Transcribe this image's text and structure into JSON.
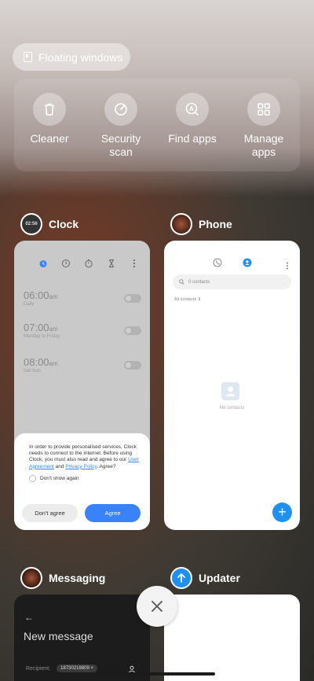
{
  "floating_windows": {
    "label": "Floating windows"
  },
  "quick_actions": [
    {
      "label": "Cleaner",
      "icon": "trash-icon"
    },
    {
      "label": "Security\nscan",
      "icon": "security-scan-icon"
    },
    {
      "label": "Find apps",
      "icon": "find-apps-icon"
    },
    {
      "label": "Manage\napps",
      "icon": "grid-icon"
    }
  ],
  "apps": {
    "clock": {
      "name": "Clock",
      "icon_text": "02:56",
      "alarms": [
        {
          "time": "06:00",
          "ampm": "am",
          "repeat": "Daily"
        },
        {
          "time": "07:00",
          "ampm": "am",
          "repeat": "Monday to Friday"
        },
        {
          "time": "08:00",
          "ampm": "am",
          "repeat": "Sat-Sun"
        }
      ],
      "dialog": {
        "text_before": "In order to provide personalised services, Clock needs to connect to the internet. Before using Clock, you must also read and agree to our ",
        "link1": "User Agreement",
        "and": " and ",
        "link2": "Privacy Policy",
        "text_after": ". Agree?",
        "dont_show": "Don't show again",
        "disagree": "Don't agree",
        "agree": "Agree"
      }
    },
    "phone": {
      "name": "Phone",
      "search_placeholder": "0 contacts",
      "filter": "All contacts",
      "empty": "No contacts"
    },
    "messaging": {
      "name": "Messaging",
      "title": "New message",
      "recipient_label": "Recipient:",
      "recipient_chip": "18730218809"
    },
    "updater": {
      "name": "Updater"
    }
  },
  "colors": {
    "accent": "#3a82f7",
    "fab": "#1f8ff0"
  }
}
